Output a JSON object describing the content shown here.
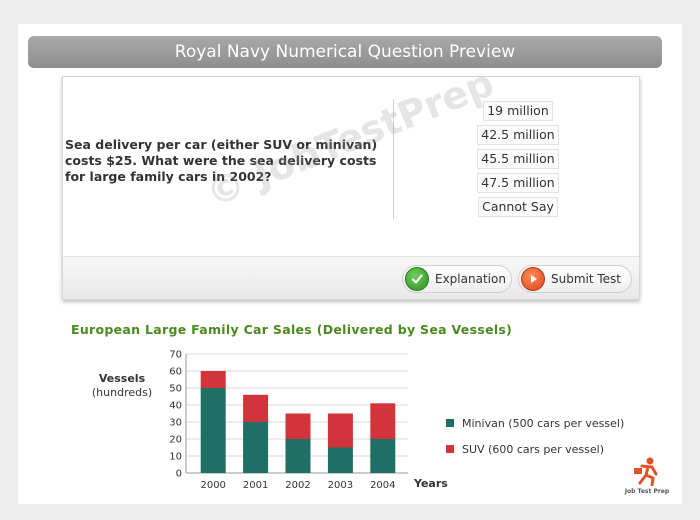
{
  "header": {
    "title": "Royal Navy Numerical Question Preview"
  },
  "question": {
    "text": "Sea delivery per car (either SUV or minivan) costs $25. What were the sea delivery costs for large family cars in 2002?",
    "options": [
      "19 million",
      "42.5 million",
      "45.5 million",
      "47.5 million",
      "Cannot Say"
    ]
  },
  "buttons": {
    "explanation": "Explanation",
    "submit": "Submit Test"
  },
  "watermark": "© JobTestPrep",
  "colors": {
    "minivan": "#1f6f66",
    "suv": "#d2343b",
    "title_green": "#4a8a1e"
  },
  "chart_data": {
    "type": "bar",
    "stacked": true,
    "title": "European Large Family Car Sales (Delivered by Sea Vessels)",
    "ylabel": [
      "Vessels",
      "(hundreds)"
    ],
    "xlabel": "Years",
    "categories": [
      "2000",
      "2001",
      "2002",
      "2003",
      "2004"
    ],
    "ylim": [
      0,
      70
    ],
    "yticks": [
      0,
      10,
      20,
      30,
      40,
      50,
      60,
      70
    ],
    "grid": true,
    "legend_position": "right",
    "series": [
      {
        "name": "Minivan (500 cars per vessel)",
        "values": [
          50,
          30,
          20,
          15,
          20
        ]
      },
      {
        "name": "SUV (600 cars per vessel)",
        "values": [
          10,
          16,
          15,
          20,
          21
        ]
      }
    ]
  },
  "logo": {
    "text": "Job Test Prep"
  }
}
